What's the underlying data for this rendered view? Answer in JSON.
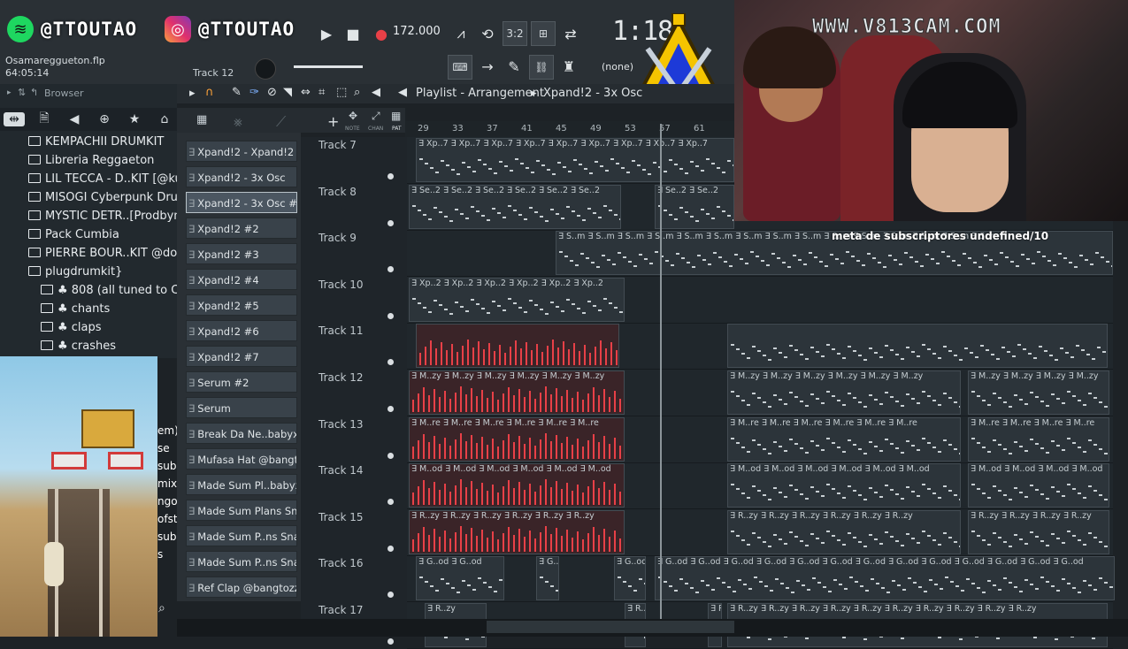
{
  "social": {
    "spotify_handle": "@TTOUTAO",
    "instagram_handle": "@TTOUTAO"
  },
  "project": {
    "file_name": "Osamareggueton.flp",
    "time": "64:05:14"
  },
  "transport": {
    "tempo": "172.000",
    "clock": "1:18",
    "pattern_label": "Track 12",
    "snap": "(none)",
    "accent_color": "#e84047"
  },
  "browser": {
    "title": "Browser",
    "items": [
      {
        "label": "KEMPACHII DRUMKIT",
        "indent": 0
      },
      {
        "label": "Libreria Reggaeton",
        "indent": 0
      },
      {
        "label": "LIL TECCA - D..KIT [@kubfu1]",
        "indent": 0
      },
      {
        "label": "MISOGI Cyberpunk Drumkit",
        "indent": 0
      },
      {
        "label": "MYSTIC DETR..[Prodbymed]",
        "indent": 0
      },
      {
        "label": "Pack Cumbia",
        "indent": 0
      },
      {
        "label": "PIERRE BOUR..KIT @dopekit",
        "indent": 0
      },
      {
        "label": "plugdrumkit}",
        "indent": 0
      },
      {
        "label": "♣ 808 (all tuned to C)",
        "indent": 1
      },
      {
        "label": "♣ chants",
        "indent": 1
      },
      {
        "label": "♣ claps",
        "indent": 1
      },
      {
        "label": "♣ crashes",
        "indent": 1
      }
    ],
    "partial_items": [
      "em)",
      "se",
      "sub",
      "mix",
      "ngo",
      "ofst",
      "sub",
      "s"
    ]
  },
  "channels": [
    {
      "label": "Xpand!2 - Xpand!2",
      "selected": false
    },
    {
      "label": "Xpand!2 - 3x Osc",
      "selected": false
    },
    {
      "label": "Xpand!2 - 3x Osc #2",
      "selected": true
    },
    {
      "label": "Xpand!2 #2",
      "selected": false
    },
    {
      "label": "Xpand!2 #3",
      "selected": false
    },
    {
      "label": "Xpand!2 #4",
      "selected": false
    },
    {
      "label": "Xpand!2 #5",
      "selected": false
    },
    {
      "label": "Xpand!2 #6",
      "selected": false
    },
    {
      "label": "Xpand!2 #7",
      "selected": false
    },
    {
      "label": "Serum #2",
      "selected": false
    },
    {
      "label": "Serum",
      "selected": false
    },
    {
      "label": "Break Da Ne..babyxprod",
      "selected": false
    },
    {
      "label": "Mufasa Hat @bangtozzy",
      "selected": false
    },
    {
      "label": "Made Sum Pl..babyxprod",
      "selected": false
    },
    {
      "label": "Made Sum Plans Snare",
      "selected": false
    },
    {
      "label": "Made Sum P..ns Snare #2",
      "selected": false
    },
    {
      "label": "Made Sum P..ns Snare #3",
      "selected": false
    },
    {
      "label": "Ref Clap @bangtozzy",
      "selected": false
    }
  ],
  "playlist": {
    "title": "Playlist - Arrangement",
    "pattern": "Xpand!2 - 3x Osc",
    "rack_labels": [
      "NOTE",
      "CHAN",
      "PAT"
    ],
    "ruler_marks": [
      "29",
      "33",
      "37",
      "41",
      "45",
      "49",
      "53",
      "57",
      "61"
    ],
    "tracks": [
      {
        "label": "Track 7",
        "clip_text": "Xp..7"
      },
      {
        "label": "Track 8",
        "clip_text": "Se..2"
      },
      {
        "label": "Track 9",
        "clip_text": "S..m"
      },
      {
        "label": "Track 10",
        "clip_text": "Xp..2"
      },
      {
        "label": "Track 11",
        "clip_text": ""
      },
      {
        "label": "Track 12",
        "clip_text": "M..zy"
      },
      {
        "label": "Track 13",
        "clip_text": "M..re"
      },
      {
        "label": "Track 14",
        "clip_text": "M..od"
      },
      {
        "label": "Track 15",
        "clip_text": "R..zy"
      },
      {
        "label": "Track 16",
        "clip_text": "G..od"
      },
      {
        "label": "Track 17",
        "clip_text": "R..zy"
      }
    ]
  },
  "overlay": {
    "subscriber_goal": "meta de subscriptores undefined/10",
    "watermark": "WWW.V813CAM.COM"
  }
}
